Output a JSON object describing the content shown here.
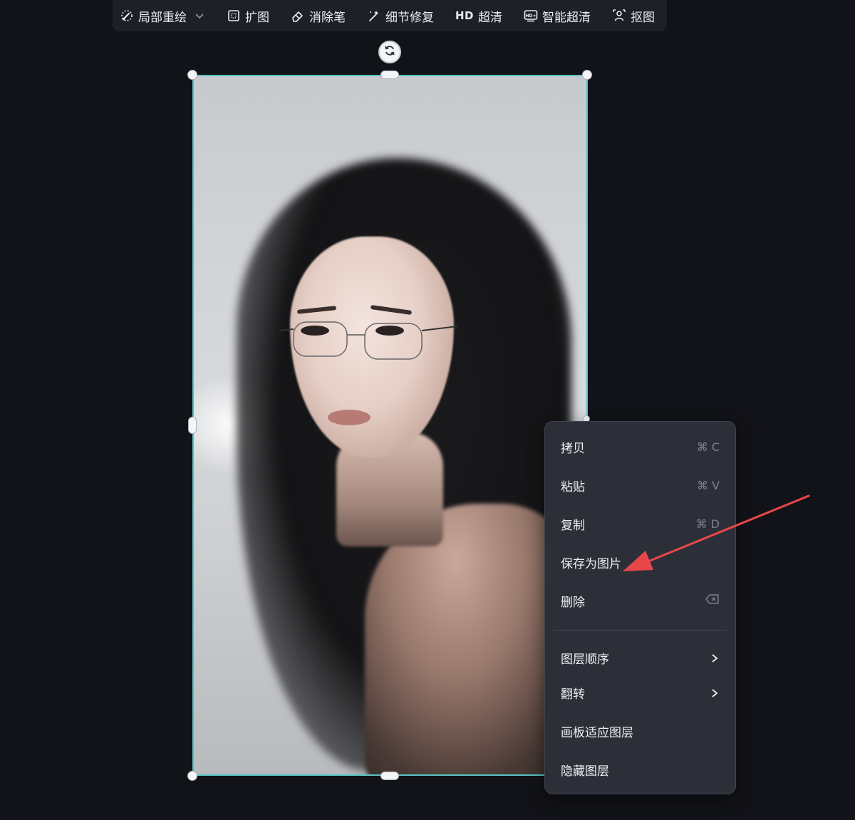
{
  "toolbar": {
    "items": [
      {
        "label": "局部重绘",
        "icon": "brush-dotted-icon"
      },
      {
        "label": "扩图",
        "icon": "expand-frame-icon"
      },
      {
        "label": "消除笔",
        "icon": "eraser-icon"
      },
      {
        "label": "细节修复",
        "icon": "magic-wand-icon"
      },
      {
        "label": "超清",
        "prefix": "HD",
        "icon": "hd-text-icon"
      },
      {
        "label": "智能超清",
        "icon": "hd-plus-icon"
      },
      {
        "label": "抠图",
        "icon": "cutout-person-icon"
      }
    ],
    "dropdown_icon": "chevron-down-icon"
  },
  "canvas": {
    "selection_color": "#58c3c2",
    "rotate_icon": "rotate-icon"
  },
  "context_menu": {
    "items": [
      {
        "label": "拷贝",
        "shortcut": "⌘ C"
      },
      {
        "label": "粘贴",
        "shortcut": "⌘ V"
      },
      {
        "label": "复制",
        "shortcut": "⌘ D"
      },
      {
        "label": "保存为图片",
        "shortcut": ""
      },
      {
        "label": "删除",
        "shortcut_icon": "backspace-icon"
      },
      {
        "label": "图层顺序",
        "submenu": true
      },
      {
        "label": "翻转",
        "submenu": true
      },
      {
        "label": "画板适应图层"
      },
      {
        "label": "隐藏图层"
      }
    ]
  },
  "annotation": {
    "color": "#e8474a",
    "target": "保存为图片"
  }
}
